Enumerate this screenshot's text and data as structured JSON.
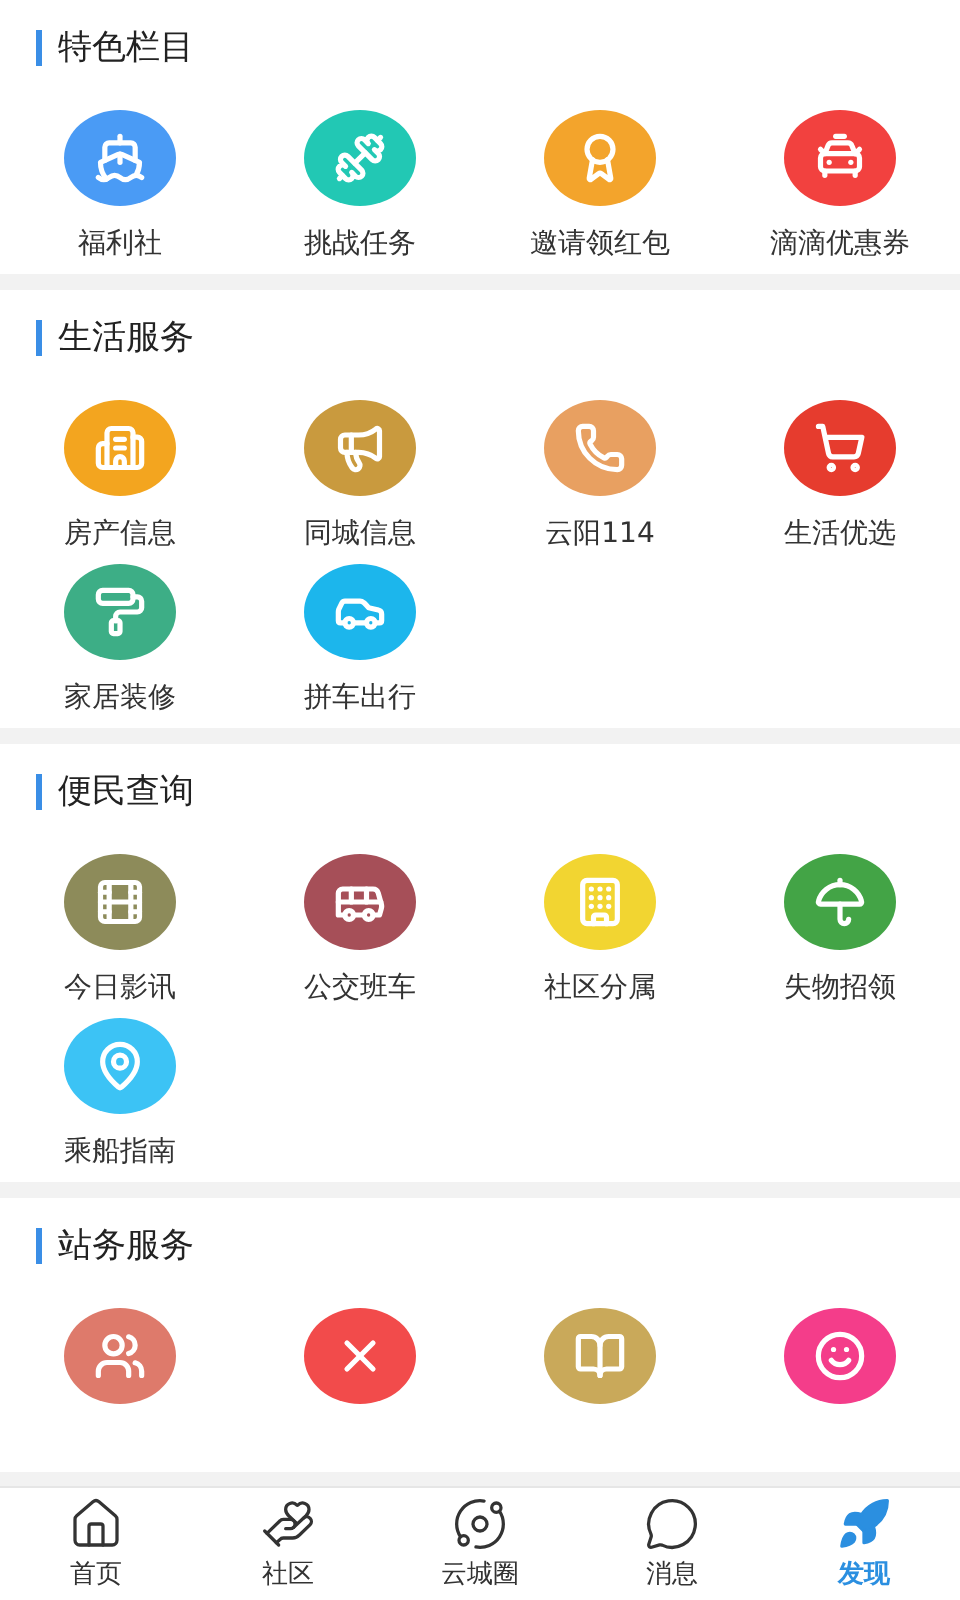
{
  "sections": [
    {
      "title": "特色栏目",
      "items": [
        {
          "label": "福利社",
          "kind": "ship",
          "color": "#4a9bf5"
        },
        {
          "label": "挑战任务",
          "kind": "dumbbell",
          "color": "#22c8b4"
        },
        {
          "label": "邀请领红包",
          "kind": "medal",
          "color": "#f3a42c"
        },
        {
          "label": "滴滴优惠券",
          "kind": "taxi",
          "color": "#f2413f"
        }
      ]
    },
    {
      "title": "生活服务",
      "items": [
        {
          "label": "房产信息",
          "kind": "buildings",
          "color": "#f3a51f"
        },
        {
          "label": "同城信息",
          "kind": "megaphone",
          "color": "#c99a3e"
        },
        {
          "label": "云阳114",
          "kind": "phone",
          "color": "#e8a061"
        },
        {
          "label": "生活优选",
          "kind": "cart",
          "color": "#e63c2e"
        },
        {
          "label": "家居装修",
          "kind": "roller",
          "color": "#3dae86"
        },
        {
          "label": "拼车出行",
          "kind": "car",
          "color": "#1cb6ec"
        }
      ]
    },
    {
      "title": "便民查询",
      "items": [
        {
          "label": "今日影讯",
          "kind": "film",
          "color": "#8d8b5a"
        },
        {
          "label": "公交班车",
          "kind": "bus",
          "color": "#a64f58"
        },
        {
          "label": "社区分属",
          "kind": "building",
          "color": "#f2d531"
        },
        {
          "label": "失物招领",
          "kind": "umbrella",
          "color": "#43a446"
        },
        {
          "label": "乘船指南",
          "kind": "pin",
          "color": "#3cc3f5"
        }
      ]
    },
    {
      "title": "站务服务",
      "items": [
        {
          "kind": "people",
          "color": "#de7a6b"
        },
        {
          "kind": "cross",
          "color": "#f24b4b"
        },
        {
          "kind": "books",
          "color": "#c9a95a"
        },
        {
          "kind": "girl",
          "color": "#f43d8a"
        }
      ]
    }
  ],
  "tabs": [
    {
      "label": "首页",
      "kind": "home",
      "selected": false
    },
    {
      "label": "社区",
      "kind": "hands",
      "selected": false
    },
    {
      "label": "云城圈",
      "kind": "orbit",
      "selected": false
    },
    {
      "label": "消息",
      "kind": "chat",
      "selected": false
    },
    {
      "label": "发现",
      "kind": "rocket",
      "selected": true
    }
  ]
}
